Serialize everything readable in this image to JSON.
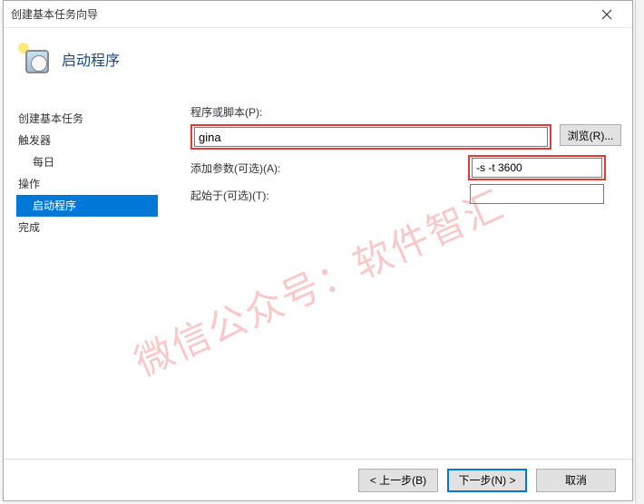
{
  "window": {
    "title": "创建基本任务向导"
  },
  "header": {
    "title": "启动程序"
  },
  "sidebar": {
    "items": [
      {
        "label": "创建基本任务",
        "selected": false,
        "sub": false
      },
      {
        "label": "触发器",
        "selected": false,
        "sub": false
      },
      {
        "label": "每日",
        "selected": false,
        "sub": true
      },
      {
        "label": "操作",
        "selected": false,
        "sub": false
      },
      {
        "label": "启动程序",
        "selected": true,
        "sub": true
      },
      {
        "label": "完成",
        "selected": false,
        "sub": false
      }
    ]
  },
  "form": {
    "program_label": "程序或脚本(P):",
    "program_value": "gina",
    "browse_label": "浏览(R)...",
    "args_label": "添加参数(可选)(A):",
    "args_value": "-s -t 3600",
    "startin_label": "起始于(可选)(T):",
    "startin_value": ""
  },
  "footer": {
    "back": "< 上一步(B)",
    "next": "下一步(N) >",
    "cancel": "取消"
  },
  "watermark": "微信公众号：软件智汇"
}
